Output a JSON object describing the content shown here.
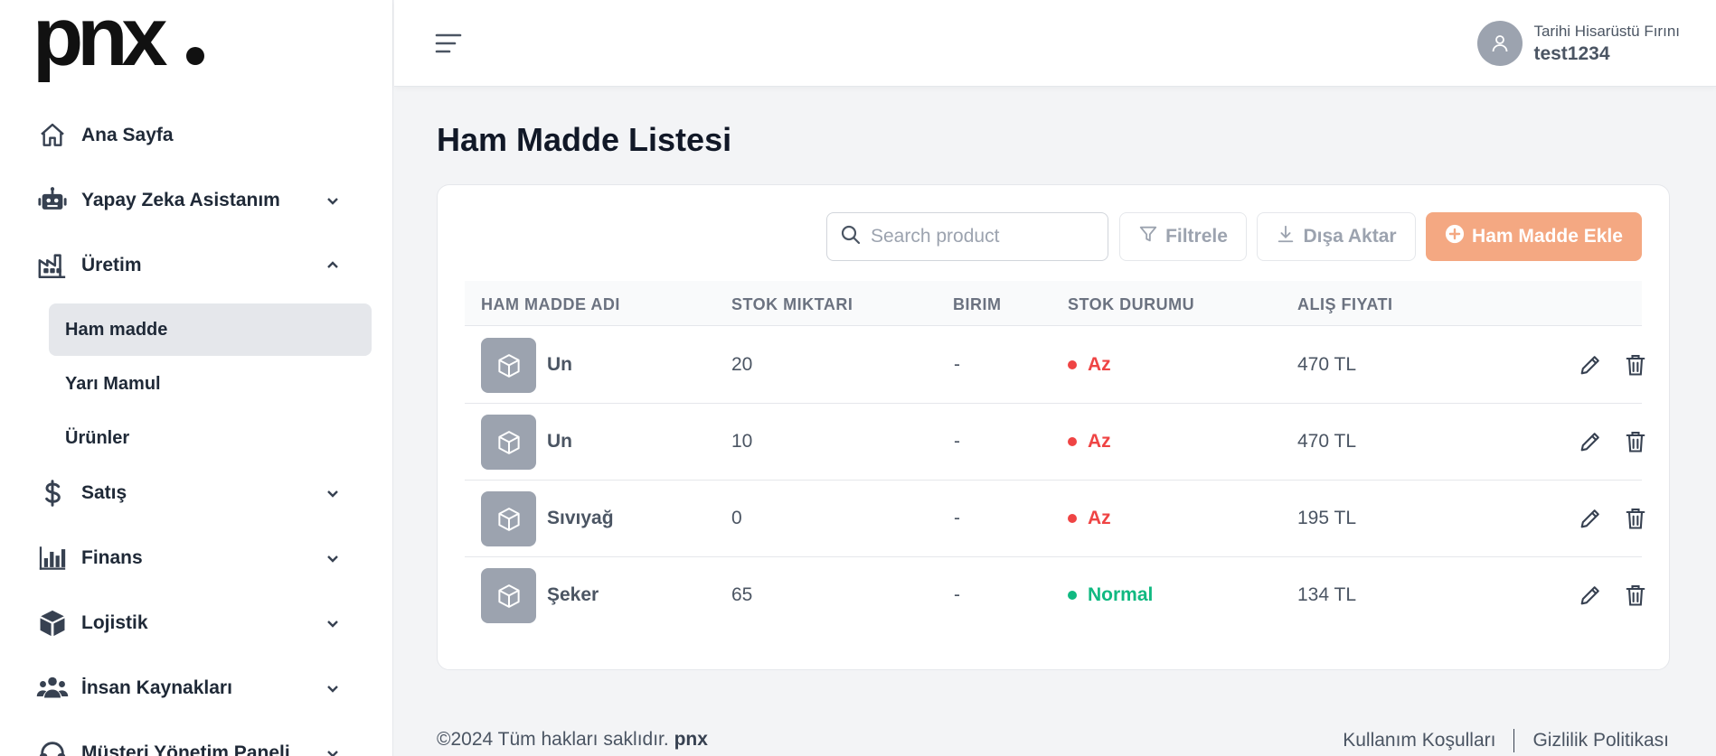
{
  "brand": {
    "logo_text": "pnx",
    "accent_color": "#f4a882"
  },
  "sidebar": {
    "items": [
      {
        "label": "Ana Sayfa",
        "icon": "home-icon"
      },
      {
        "label": "Yapay Zeka Asistanım",
        "icon": "robot-icon"
      },
      {
        "label": "Üretim",
        "icon": "factory-icon"
      },
      {
        "label": "Satış",
        "icon": "dollar-icon"
      },
      {
        "label": "Finans",
        "icon": "bar-chart-icon"
      },
      {
        "label": "Lojistik",
        "icon": "box-icon"
      },
      {
        "label": "İnsan Kaynakları",
        "icon": "users-icon"
      },
      {
        "label": "Müşteri Yönetim Paneli",
        "icon": "headset-icon"
      }
    ],
    "sub_items": [
      {
        "label": "Ham madde",
        "active": true
      },
      {
        "label": "Yarı Mamul",
        "active": false
      },
      {
        "label": "Ürünler",
        "active": false
      }
    ]
  },
  "header": {
    "company": "Tarihi Hisarüstü Fırını",
    "username": "test1234"
  },
  "main": {
    "title": "Ham Madde Listesi",
    "search_placeholder": "Search product",
    "filter_label": "Filtrele",
    "export_label": "Dışa Aktar",
    "add_label": "Ham Madde Ekle",
    "columns": [
      "HAM MADDE ADI",
      "STOK MIKTARI",
      "BIRIM",
      "STOK DURUMU",
      "ALIŞ FIYATI"
    ],
    "rows": [
      {
        "name": "Un",
        "stock": "20",
        "unit": "-",
        "status": "Az",
        "price": "470 TL"
      },
      {
        "name": "Un",
        "stock": "10",
        "unit": "-",
        "status": "Az",
        "price": "470 TL"
      },
      {
        "name": "Sıvıyağ",
        "stock": "0",
        "unit": "-",
        "status": "Az",
        "price": "195 TL"
      },
      {
        "name": "Şeker",
        "stock": "65",
        "unit": "-",
        "status": "Normal",
        "price": "134 TL"
      }
    ],
    "status_colors": {
      "low": "#ef4444",
      "normal": "#10b981"
    }
  },
  "footer": {
    "copyright": "©2024 Tüm hakları saklıdır.",
    "brand": "pnx",
    "terms": "Kullanım Koşulları",
    "privacy": "Gizlilik Politikası"
  }
}
